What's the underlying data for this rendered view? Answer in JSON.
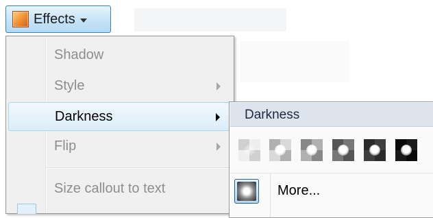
{
  "toolbar": {
    "effects_label": "Effects",
    "effects_icon": "effects-icon"
  },
  "menu": {
    "items": [
      {
        "label": "Shadow",
        "enabled": false,
        "has_submenu": false,
        "selected": false
      },
      {
        "label": "Style",
        "enabled": false,
        "has_submenu": true,
        "selected": false
      },
      {
        "label": "Darkness",
        "enabled": true,
        "has_submenu": true,
        "selected": true
      },
      {
        "label": "Flip",
        "enabled": false,
        "has_submenu": true,
        "selected": false
      },
      {
        "label": "Size callout to text",
        "enabled": false,
        "has_submenu": false,
        "selected": false
      }
    ]
  },
  "submenu": {
    "title": "Darkness",
    "swatches": [
      "darkness-1-icon",
      "darkness-2-icon",
      "darkness-3-icon",
      "darkness-4-icon",
      "darkness-5-icon",
      "darkness-6-icon"
    ],
    "more_label": "More..."
  },
  "colors": {
    "accent_border": "#3c7fb1",
    "selected_border": "#a8d8eb",
    "disabled_text": "#8d8d8d",
    "header_bg": "#dde4ee"
  }
}
